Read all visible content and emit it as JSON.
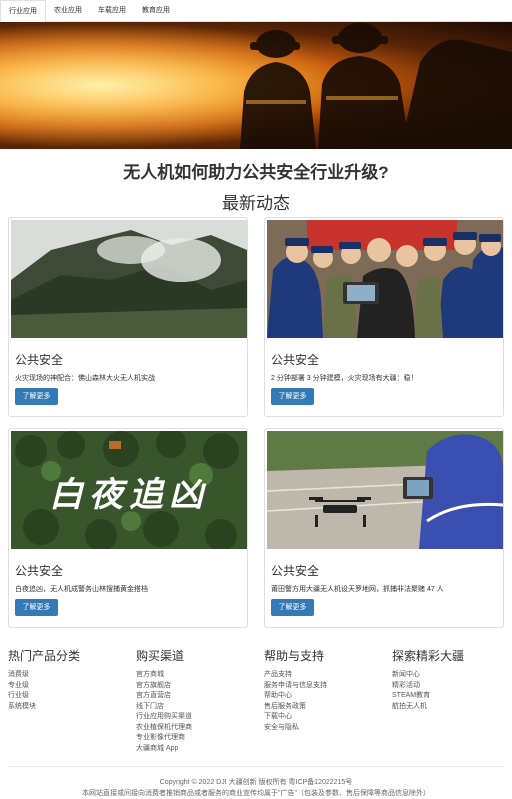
{
  "tabs": [
    {
      "label": "行业应用"
    },
    {
      "label": "农业应用"
    },
    {
      "label": "车载应用"
    },
    {
      "label": "教育应用"
    }
  ],
  "headline": "无人机如何助力公共安全行业升级?",
  "subhead": "最新动态",
  "cards": [
    {
      "title": "公共安全",
      "text": "火灾现场的神配合：佛山森林大火无人机实战",
      "button": "了解更多"
    },
    {
      "title": "公共安全",
      "text": "2 分钟部署 3 分钟建模，火灾现场有大疆：稳！",
      "button": "了解更多"
    },
    {
      "title": "公共安全",
      "text": "白夜追凶，无人机成警务山林搜捕黄金搭档",
      "button": "了解更多",
      "image_text": "白夜追凶"
    },
    {
      "title": "公共安全",
      "text": "莆田警方用大疆无人机设天罗地网，抓捕非法聚赌 47 人",
      "button": "了解更多"
    }
  ],
  "footer": {
    "columns": [
      {
        "title": "热门产品分类",
        "links": [
          "消费级",
          "专业级",
          "行业级",
          "系统模块"
        ]
      },
      {
        "title": "购买渠道",
        "links": [
          "官方商城",
          "官方旗舰店",
          "官方直营店",
          "线下门店",
          "行业应用购买渠道",
          "农业植保机代理商",
          "专业影像代理商",
          "大疆商城 App"
        ]
      },
      {
        "title": "帮助与支持",
        "links": [
          "产品支持",
          "服务申请与信息支持",
          "帮助中心",
          "售后服务政策",
          "下载中心",
          "安全与隐私"
        ]
      },
      {
        "title": "探索精彩大疆",
        "links": [
          "新闻中心",
          "精彩活动",
          "STEAM教育",
          "航拍无人机"
        ]
      }
    ],
    "copyright": "Copyright © 2022 DJI 大疆创新 版权所有 粤ICP备12022215号",
    "note": "本网站直接或间接向消费者推销商品或者服务的商业宣传均属于\"广告\"（包装及参数、售后保障等商品信息除外）"
  }
}
